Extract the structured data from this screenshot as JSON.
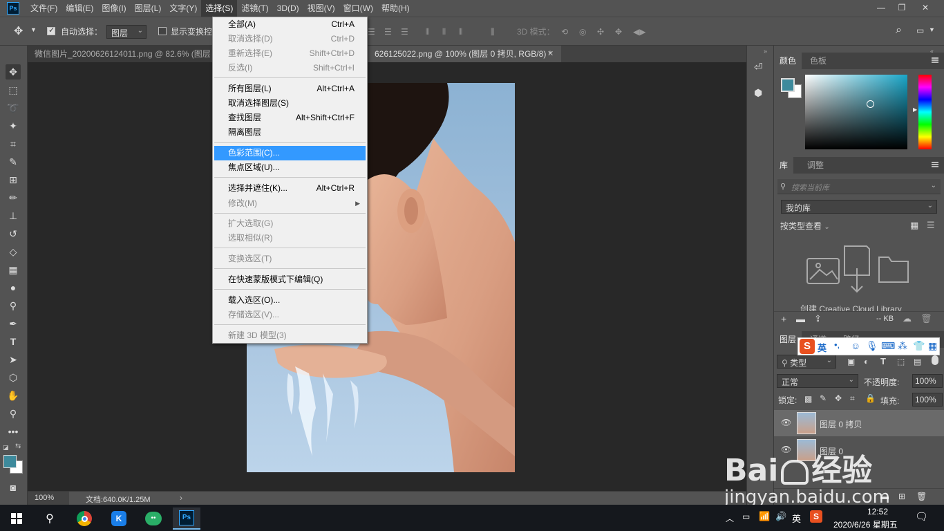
{
  "menubar": {
    "logo": "Ps",
    "items": [
      "文件(F)",
      "编辑(E)",
      "图像(I)",
      "图层(L)",
      "文字(Y)",
      "选择(S)",
      "滤镜(T)",
      "3D(D)",
      "视图(V)",
      "窗口(W)",
      "帮助(H)"
    ]
  },
  "optbar": {
    "auto_select_label": "自动选择：",
    "auto_select_value": "图层",
    "show_transform_label": "显示变换控",
    "three_d_mode_label": "3D 模式："
  },
  "tabs": [
    {
      "label": "微信图片_20200626124011.png @ 82.6% (图层"
    },
    {
      "label": "626125022.png @ 100% (图层 0 拷贝, RGB/8) *"
    }
  ],
  "select_menu": {
    "items": [
      {
        "label": "全部(A)",
        "shortcut": "Ctrl+A",
        "disabled": false
      },
      {
        "label": "取消选择(D)",
        "shortcut": "Ctrl+D",
        "disabled": true
      },
      {
        "label": "重新选择(E)",
        "shortcut": "Shift+Ctrl+D",
        "disabled": true
      },
      {
        "label": "反选(I)",
        "shortcut": "Shift+Ctrl+I",
        "disabled": true
      },
      {
        "label": "所有图层(L)",
        "shortcut": "Alt+Ctrl+A",
        "disabled": false
      },
      {
        "label": "取消选择图层(S)",
        "shortcut": "",
        "disabled": false
      },
      {
        "label": "查找图层",
        "shortcut": "Alt+Shift+Ctrl+F",
        "disabled": false
      },
      {
        "label": "隔离图层",
        "shortcut": "",
        "disabled": false
      },
      {
        "label": "色彩范围(C)...",
        "shortcut": "",
        "disabled": false,
        "highlighted": true
      },
      {
        "label": "焦点区域(U)...",
        "shortcut": "",
        "disabled": false
      },
      {
        "label": "选择并遮住(K)...",
        "shortcut": "Alt+Ctrl+R",
        "disabled": false
      },
      {
        "label": "修改(M)",
        "shortcut": "",
        "disabled": true,
        "submenu": true
      },
      {
        "label": "扩大选取(G)",
        "shortcut": "",
        "disabled": true
      },
      {
        "label": "选取相似(R)",
        "shortcut": "",
        "disabled": true
      },
      {
        "label": "变换选区(T)",
        "shortcut": "",
        "disabled": true
      },
      {
        "label": "在快速蒙版模式下编辑(Q)",
        "shortcut": "",
        "disabled": false
      },
      {
        "label": "载入选区(O)...",
        "shortcut": "",
        "disabled": false
      },
      {
        "label": "存储选区(V)...",
        "shortcut": "",
        "disabled": true
      },
      {
        "label": "新建 3D 模型(3)",
        "shortcut": "",
        "disabled": true
      }
    ]
  },
  "statusbar": {
    "zoom": "100%",
    "doc_info": "文档:640.0K/1.25M"
  },
  "color_panel": {
    "tab_color": "颜色",
    "tab_swatches": "色板",
    "foreground": "#3d8a9c",
    "background": "#ffffff",
    "hue_color": "#1aa6c8"
  },
  "library_panel": {
    "tab_library": "库",
    "tab_adjust": "调整",
    "search_placeholder": "搜索当前库",
    "library_name": "我的库",
    "view_by": "按类型查看",
    "create_text": "创建 Creative Cloud Library",
    "size": "-- KB"
  },
  "layers_panel": {
    "tab_layers": "图层",
    "tab_channels": "通道",
    "tab_paths": "路径",
    "filter_kind": "类型",
    "blend_mode": "正常",
    "opacity_label": "不透明度:",
    "opacity_value": "100%",
    "lock_label": "锁定:",
    "fill_label": "填充:",
    "fill_value": "100%",
    "layers": [
      {
        "name": "图层 0 拷贝",
        "selected": true
      },
      {
        "name": "图层 0",
        "selected": false
      }
    ]
  },
  "ime": {
    "logo": "S",
    "lang": "英"
  },
  "watermark": {
    "brand": "Bai",
    "brand_tail": "经验",
    "url": "jingyan.baidu.com"
  },
  "taskbar": {
    "time": "12:52",
    "date": "2020/6/26 星期五",
    "ime_lang": "英"
  }
}
